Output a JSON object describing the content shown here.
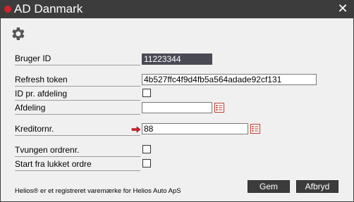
{
  "window": {
    "title": "AD Danmark",
    "close_glyph": "✕",
    "accent_color": "#d2232a"
  },
  "toolbar": {
    "settings_icon": "gear-icon"
  },
  "form": {
    "bruger_id": {
      "label": "Bruger ID",
      "value": "11223344"
    },
    "refresh_token": {
      "label": "Refresh token",
      "value": "4b527ffc4f9d4fb5a564adade92cf131"
    },
    "id_pr_afdeling": {
      "label": "ID pr. afdeling",
      "checked": false
    },
    "afdeling": {
      "label": "Afdeling",
      "value": ""
    },
    "kreditornr": {
      "label": "Kreditornr.",
      "value": "88"
    },
    "tvungen_ordrenr": {
      "label": "Tvungen ordrenr.",
      "checked": false
    },
    "start_fra_lukket_ordre": {
      "label": "Start fra lukket ordre",
      "checked": false
    }
  },
  "footer": {
    "trademark": "Helios® er et registreret varemærke for Helios Auto ApS",
    "save_label": "Gem",
    "cancel_label": "Afbryd"
  }
}
